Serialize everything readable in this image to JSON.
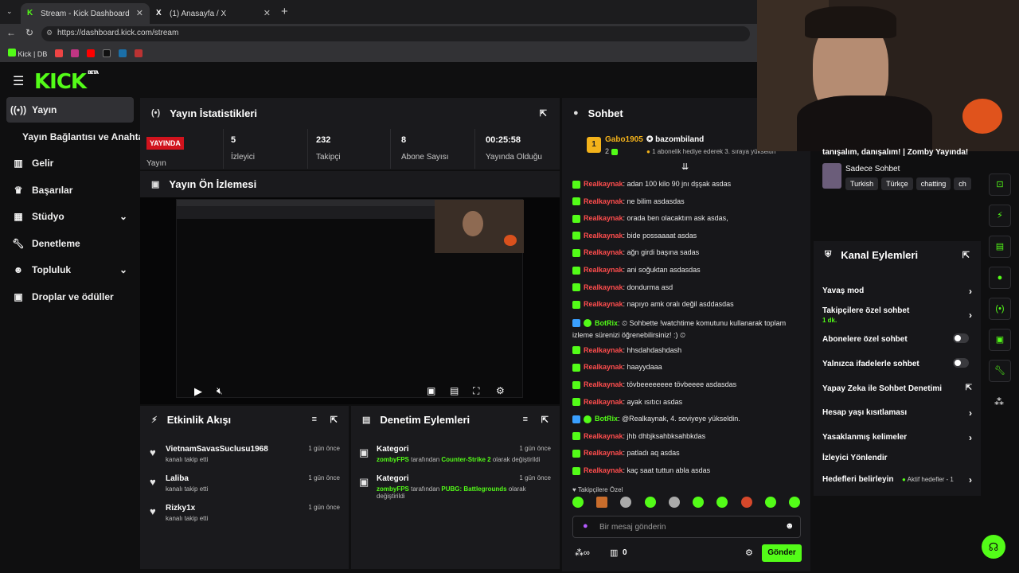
{
  "browser": {
    "tabs": [
      {
        "title": "Stream - Kick Dashboard"
      },
      {
        "title": "(1) Anasayfa / X"
      }
    ],
    "url": "https://dashboard.kick.com/stream",
    "bookmarks": [
      {
        "label": "Kick | DB"
      }
    ]
  },
  "brand": {
    "logo": "KICK",
    "beta": "BETA",
    "accent": "#53fc18"
  },
  "sidebar": {
    "items": [
      {
        "label": "Yayın",
        "icon": "broadcast-icon"
      },
      {
        "label": "Yayın Bağlantısı ve Anahtarı"
      },
      {
        "label": "Gelir",
        "icon": "chart-icon"
      },
      {
        "label": "Başarılar",
        "icon": "trophy-icon"
      },
      {
        "label": "Stüdyo",
        "icon": "grid-icon"
      },
      {
        "label": "Denetleme",
        "icon": "wrench-icon"
      },
      {
        "label": "Topluluk",
        "icon": "users-icon"
      },
      {
        "label": "Droplar ve ödüller",
        "icon": "gift-icon"
      }
    ]
  },
  "stats": {
    "title": "Yayın İstatistikleri",
    "live_badge": "YAYINDA",
    "live_label": "Yayın",
    "items": [
      {
        "value": "5",
        "label": "İzleyici"
      },
      {
        "value": "232",
        "label": "Takipçi"
      },
      {
        "value": "8",
        "label": "Abone Sayısı"
      },
      {
        "value": "00:25:58",
        "label": "Yayında Olduğu"
      }
    ]
  },
  "preview": {
    "title": "Yayın Ön İzlemesi"
  },
  "feed": {
    "title": "Etkinlik Akışı",
    "items": [
      {
        "name": "VietnamSavasSuclusu1968",
        "sub": "kanalı takip etti",
        "time": "1 gün önce"
      },
      {
        "name": "Laliba",
        "sub": "kanalı takip etti",
        "time": "1 gün önce"
      },
      {
        "name": "Rizky1x",
        "sub": "kanalı takip etti",
        "time": "1 gün önce"
      }
    ]
  },
  "mod": {
    "title": "Denetim Eylemleri",
    "items": [
      {
        "title": "Kategori",
        "user": "zombyFPS",
        "mid": " tarafından ",
        "cat": "Counter-Strike 2",
        "tail": " olarak değiştirildi",
        "time": "1 gün önce"
      },
      {
        "title": "Kategori",
        "user": "zombyFPS",
        "mid": " tarafından ",
        "cat": "PUBG: Battlegrounds",
        "tail": " olarak",
        "tail2": "değiştirildi",
        "time": "1 gün önce"
      }
    ]
  },
  "chat": {
    "title": "Sohbet",
    "pinned": {
      "user1": "Gabo1905",
      "count": "2",
      "user2": "bazombiland",
      "text": "1 abonelik hediye ederek 3. sıraya yükseltin"
    },
    "messages": [
      {
        "user": "Realkaynak",
        "text": ": adan 100 kilo 90 jnı dşşak asdas"
      },
      {
        "user": "Realkaynak",
        "text": ": ne bilim asdasdas"
      },
      {
        "user": "Realkaynak",
        "text": ": orada ben olacaktım ask asdas,"
      },
      {
        "user": "Realkaynak",
        "text": ": bide possaaaat asdas"
      },
      {
        "user": "Realkaynak",
        "text": ": ağn girdi başına sadas"
      },
      {
        "user": "Realkaynak",
        "text": ": ani soğuktan asdasdas"
      },
      {
        "user": "Realkaynak",
        "text": ": dondurma asd"
      },
      {
        "user": "Realkaynak",
        "text": ": napıyo amk oralı değil asddasdas"
      },
      {
        "user": "BotRix",
        "text": ": ⏲ Sohbette !watchtime komutunu kullanarak toplam",
        "text2": "izleme sürenizi öğrenebilirsiniz! :) ⏲"
      },
      {
        "user": "Realkaynak",
        "text": ": hhsdahdashdash"
      },
      {
        "user": "Realkaynak",
        "text": ": haayydaaa"
      },
      {
        "user": "Realkaynak",
        "text": ": tövbeeeeeeee tövbeeee asdasdas"
      },
      {
        "user": "Realkaynak",
        "text": ": ayak ısıtıcı asdas"
      },
      {
        "user": "BotRix",
        "text": ": @Realkaynak, 4. seviyeye yükseldin."
      },
      {
        "user": "Realkaynak",
        "text": ": jhb dhbjksahbksahbkdas"
      },
      {
        "user": "Realkaynak",
        "text": ": patladı aq asdas"
      },
      {
        "user": "Realkaynak",
        "text": ": kaç saat tuttun abla asdas"
      }
    ],
    "followers_only": "Takipçilere Özel",
    "placeholder": "Bir mesaj gönderin",
    "points": "0",
    "send": "Gönder"
  },
  "info": {
    "headline": "tanışalım, danışalım! | Zomby Yayında!",
    "mode": "Sadece Sohbet",
    "tags": [
      "Turkish",
      "Türkçe",
      "chatting",
      "ch"
    ]
  },
  "actions": {
    "title": "Kanal Eylemleri",
    "items": [
      {
        "label": "Yavaş mod",
        "type": "chevron"
      },
      {
        "label": "Takipçilere özel sohbet",
        "sub": "1 dk.",
        "type": "chevron"
      },
      {
        "label": "Abonelere özel sohbet",
        "type": "toggle"
      },
      {
        "label": "Yalnızca ifadelerle sohbet",
        "type": "toggle"
      },
      {
        "label": "Yapay Zeka ile Sohbet Denetimi",
        "type": "link"
      },
      {
        "label": "Hesap yaşı kısıtlaması",
        "type": "chevron"
      },
      {
        "label": "Yasaklanmış kelimeler",
        "type": "chevron"
      },
      {
        "label": "İzleyici Yönlendir",
        "type": "none"
      },
      {
        "label": "Hedefleri belirleyin",
        "sub": "Aktif hedefler - 1",
        "type": "chevron"
      }
    ]
  }
}
